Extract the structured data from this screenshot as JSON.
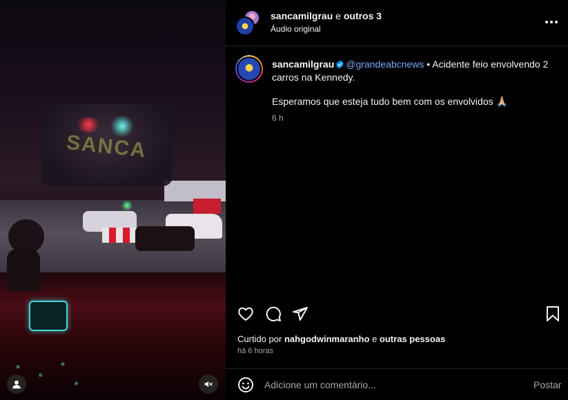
{
  "media": {
    "watermark": "SANCA",
    "profile_icon": "user-icon",
    "mute_icon": "volume-muted-icon"
  },
  "header": {
    "username": "sancamilgrau",
    "connector": "e",
    "others": "outros 3",
    "audio": "Áudio original",
    "more_icon": "more-horizontal-icon"
  },
  "caption": {
    "username": "sancamilgrau",
    "mention": "@grandeabcnews",
    "text_1": " • Acidente feio envolvendo 2 carros na Kennedy.",
    "text_2": "Esperamos que esteja tudo bem com os envolvidos 🙏🏼",
    "time": "6 h"
  },
  "actions": {
    "like_icon": "heart-icon",
    "comment_icon": "comment-icon",
    "share_icon": "send-icon",
    "save_icon": "bookmark-icon"
  },
  "likes": {
    "prefix": "Curtido por",
    "user": "nahgodwinmaranho",
    "connector": "e",
    "others": "outras pessoas"
  },
  "posted_ago": "há 6 horas",
  "comment": {
    "placeholder": "Adicione um comentário...",
    "post_label": "Postar",
    "emoji_icon": "smiley-icon"
  },
  "colors": {
    "background": "#000000",
    "text": "#f5f5f5",
    "secondary_text": "#a8a8a8",
    "mention": "#7aa7ff",
    "verified": "#0095f6",
    "divider": "#262626"
  }
}
